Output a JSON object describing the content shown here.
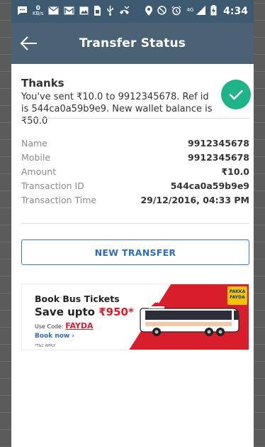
{
  "status_bar": {
    "kb_value": "0",
    "kb_unit": "KB/s",
    "network": "4G",
    "time": "4:34"
  },
  "app_bar": {
    "title": "Transfer Status",
    "back_icon": "arrow-left-icon"
  },
  "confirmation": {
    "title": "Thanks",
    "message": "You've sent  ₹10.0 to 9912345678. Ref id is 544ca0a59b9e9. New wallet balance is  ₹50.0",
    "status_icon": "checkmark-icon",
    "status_color": "#1fb38a"
  },
  "details": [
    {
      "label": "Name",
      "value": "9912345678"
    },
    {
      "label": "Mobile",
      "value": "9912345678"
    },
    {
      "label": "Amount",
      "value": "₹10.0"
    },
    {
      "label": "Transaction ID",
      "value": "544ca0a59b9e9"
    },
    {
      "label": "Transaction Time",
      "value": "29/12/2016, 04:33 PM"
    }
  ],
  "actions": {
    "new_transfer_label": "NEW TRANSFER"
  },
  "banner": {
    "title": "Book Bus Tickets",
    "save_prefix": "Save upto ",
    "save_amount": "₹950*",
    "code_prefix": "Use Code: ",
    "code": "FAYDA",
    "cta": "Book now",
    "tc": "*T&C APPLY",
    "logo_line1": "PAKKA",
    "logo_line2": "FAYDA",
    "accent_color": "#d81e2c"
  },
  "colors": {
    "status_bar": "#3e5a70",
    "app_bar": "#4a6273",
    "link": "#2e6db7"
  }
}
